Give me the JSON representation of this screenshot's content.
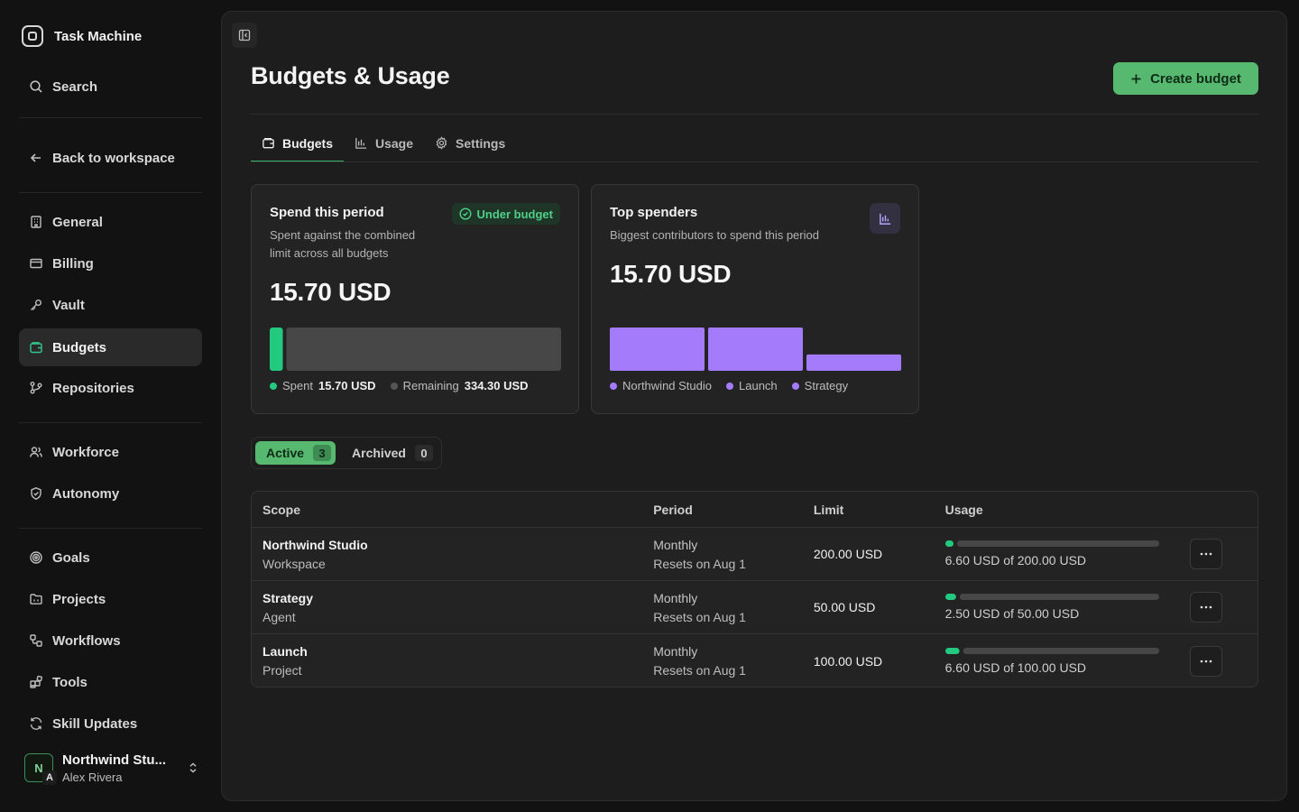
{
  "app": {
    "name": "Task Machine"
  },
  "sidebar": {
    "search_label": "Search",
    "back_label": "Back to workspace",
    "items": [
      {
        "label": "General",
        "icon": "building-icon"
      },
      {
        "label": "Billing",
        "icon": "credit-card-icon"
      },
      {
        "label": "Vault",
        "icon": "key-icon"
      },
      {
        "label": "Budgets",
        "icon": "wallet-icon",
        "active": true
      },
      {
        "label": "Repositories",
        "icon": "git-branch-icon"
      },
      {
        "label": "Workforce",
        "icon": "users-icon"
      },
      {
        "label": "Autonomy",
        "icon": "shield-check-icon"
      },
      {
        "label": "Goals",
        "icon": "target-icon"
      },
      {
        "label": "Projects",
        "icon": "folder-icon"
      },
      {
        "label": "Workflows",
        "icon": "workflow-icon"
      },
      {
        "label": "Tools",
        "icon": "blocks-icon"
      },
      {
        "label": "Skill Updates",
        "icon": "refresh-icon"
      }
    ],
    "account": {
      "avatar_letter": "N",
      "avatar_sub_letter": "A",
      "name": "Northwind Stu...",
      "user": "Alex Rivera"
    }
  },
  "header": {
    "title": "Budgets & Usage",
    "create_label": "Create budget"
  },
  "tabs": [
    {
      "label": "Budgets",
      "icon": "wallet-icon",
      "active": true
    },
    {
      "label": "Usage",
      "icon": "bar-chart-icon"
    },
    {
      "label": "Settings",
      "icon": "gear-icon"
    }
  ],
  "spend_card": {
    "title": "Spend this period",
    "description_line1": "Spent against the combined",
    "description_line2": "limit across all budgets",
    "badge": "Under budget",
    "amount": "15.70 USD",
    "spent_fraction": 0.0449,
    "legend_spent_label": "Spent",
    "legend_spent_value": "15.70 USD",
    "legend_remaining_label": "Remaining",
    "legend_remaining_value": "334.30 USD",
    "colors": {
      "spent": "#22c97f",
      "remaining": "#474747"
    }
  },
  "spenders_card": {
    "title": "Top spenders",
    "description": "Biggest contributors to spend this period",
    "amount": "15.70 USD",
    "color": "#a47bfb",
    "spenders": [
      {
        "name": "Northwind Studio",
        "amount": 6.6
      },
      {
        "name": "Launch",
        "amount": 6.6
      },
      {
        "name": "Strategy",
        "amount": 2.5
      }
    ]
  },
  "filter": {
    "active_label": "Active",
    "active_count": "3",
    "archived_label": "Archived",
    "archived_count": "0"
  },
  "table": {
    "headers": {
      "scope": "Scope",
      "period": "Period",
      "limit": "Limit",
      "usage": "Usage"
    },
    "rows": [
      {
        "name": "Northwind Studio",
        "type": "Workspace",
        "period": "Monthly",
        "reset": "Resets on Aug 1",
        "limit": "200.00 USD",
        "usage_text": "6.60 USD of 200.00 USD",
        "usage_fraction": 0.033
      },
      {
        "name": "Strategy",
        "type": "Agent",
        "period": "Monthly",
        "reset": "Resets on Aug 1",
        "limit": "50.00 USD",
        "usage_text": "2.50 USD of 50.00 USD",
        "usage_fraction": 0.05
      },
      {
        "name": "Launch",
        "type": "Project",
        "period": "Monthly",
        "reset": "Resets on Aug 1",
        "limit": "100.00 USD",
        "usage_text": "6.60 USD of 100.00 USD",
        "usage_fraction": 0.066
      }
    ]
  },
  "colors": {
    "accent": "#57b86f",
    "usage": "#22c97f",
    "track": "#474747"
  }
}
